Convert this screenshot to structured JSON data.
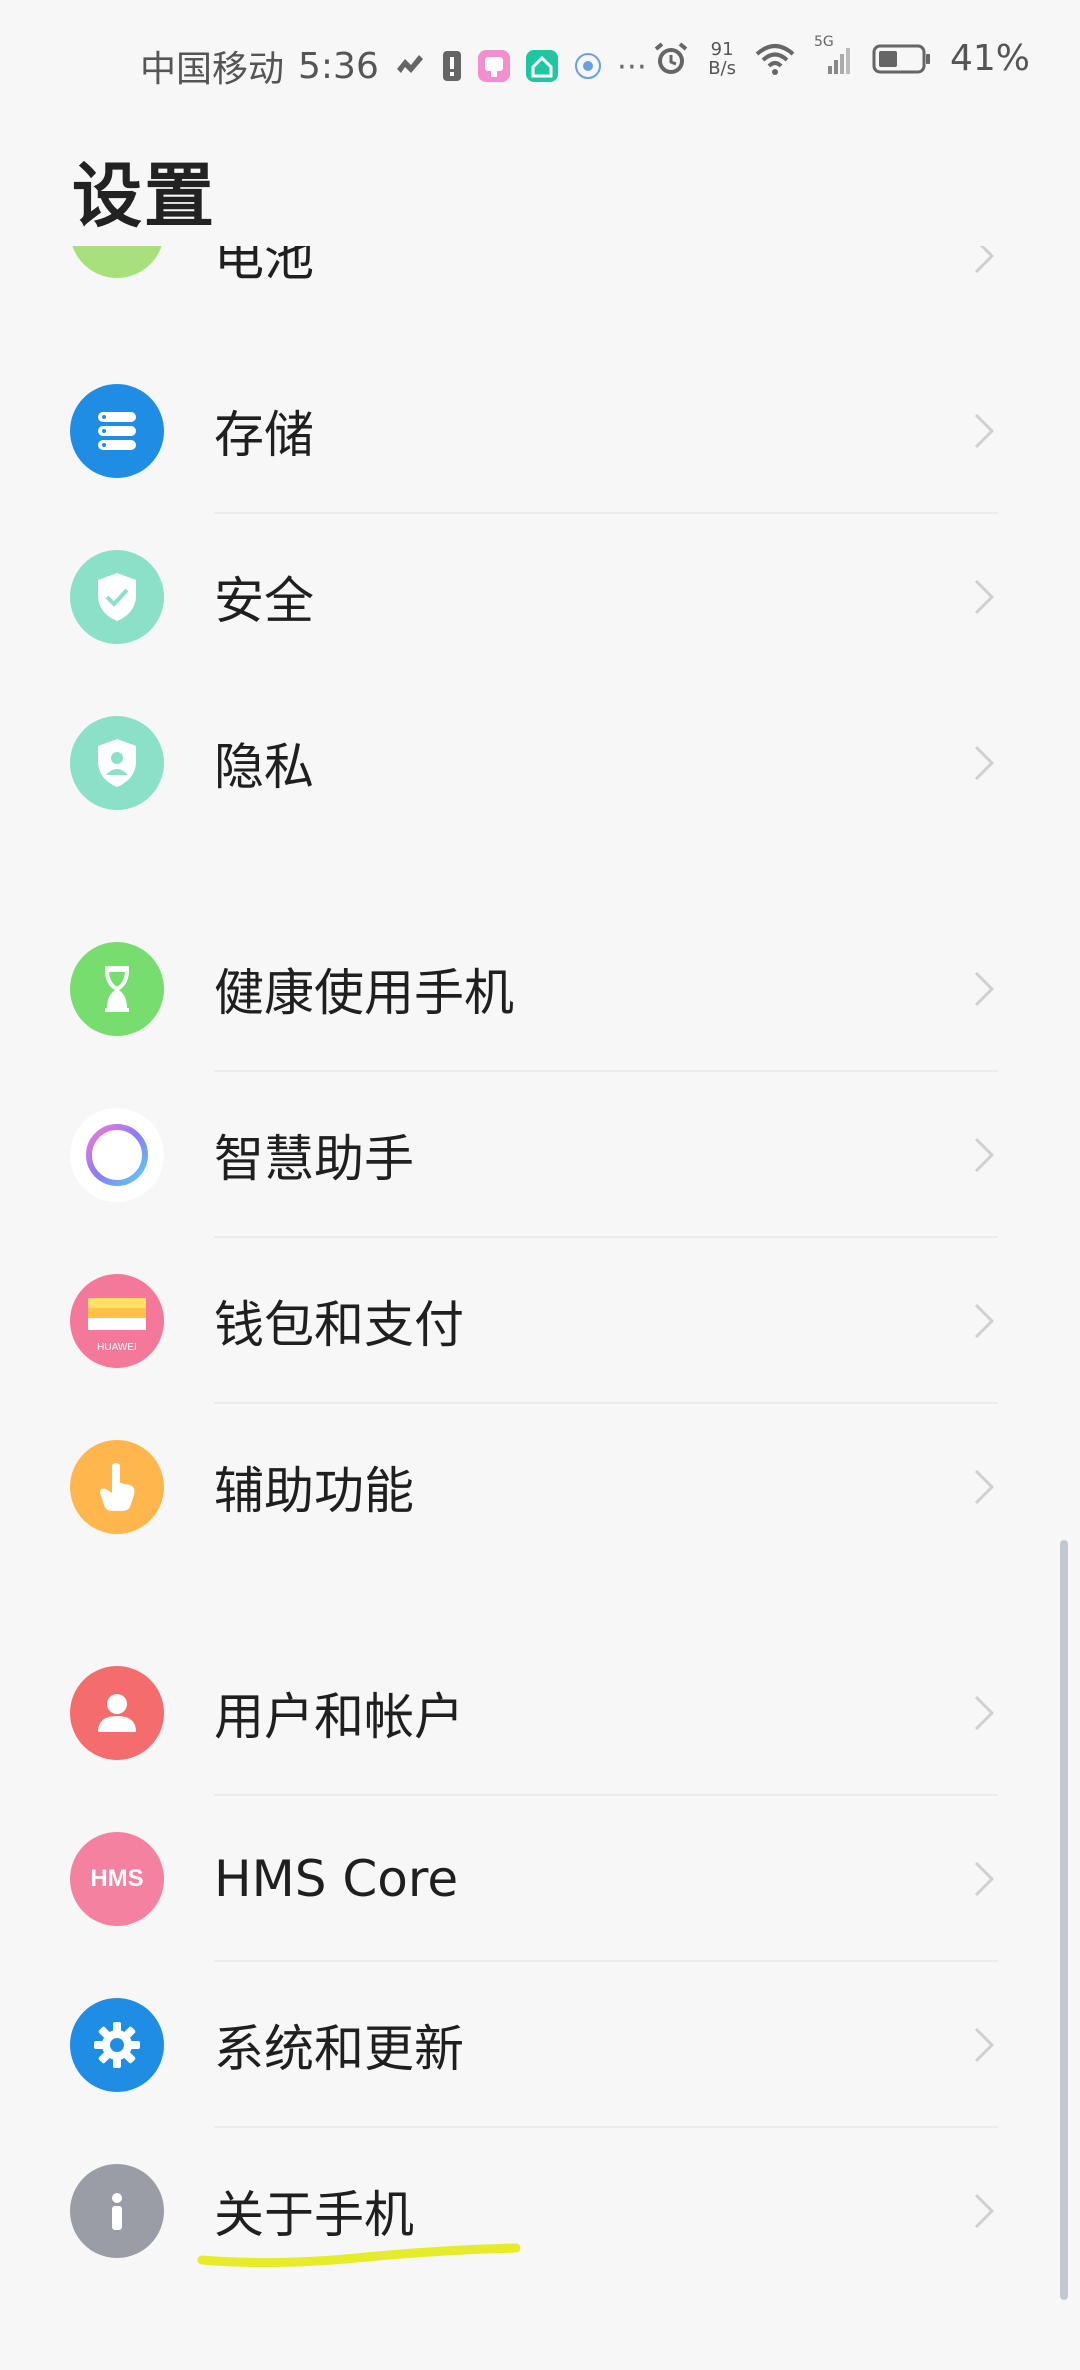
{
  "status_bar": {
    "carrier": "中国移动",
    "time": "5:36",
    "speed_value": "91",
    "speed_unit": "B/s",
    "network": "5G",
    "battery_pct": "41%"
  },
  "page": {
    "title": "设置"
  },
  "menu_items": [
    {
      "label": "电池",
      "icon": "battery-icon",
      "color": "#a8e07c"
    },
    {
      "label": "存储",
      "icon": "storage-icon",
      "color": "#1e8de3"
    },
    {
      "label": "安全",
      "icon": "shield-check-icon",
      "color": "#8be0c8"
    },
    {
      "label": "隐私",
      "icon": "privacy-icon",
      "color": "#8be0c8"
    },
    {
      "label": "健康使用手机",
      "icon": "hourglass-icon",
      "color": "#77dd6e"
    },
    {
      "label": "智慧助手",
      "icon": "assistant-ring-icon",
      "color": "#ffffff"
    },
    {
      "label": "钱包和支付",
      "icon": "wallet-icon",
      "color": "#f4789a",
      "badge": "HUAWEI"
    },
    {
      "label": "辅助功能",
      "icon": "hand-pointer-icon",
      "color": "#ffb64d"
    },
    {
      "label": "用户和帐户",
      "icon": "user-icon",
      "color": "#f56c6c"
    },
    {
      "label": "HMS Core",
      "icon": "hms-icon",
      "color": "#f481a0",
      "badge": "HMS"
    },
    {
      "label": "系统和更新",
      "icon": "gear-icon",
      "color": "#1e8de3"
    },
    {
      "label": "关于手机",
      "icon": "info-icon",
      "color": "#9a9ca6"
    }
  ],
  "colors": {
    "highlight": "#e6ec2a",
    "background": "#f7f7f7"
  }
}
